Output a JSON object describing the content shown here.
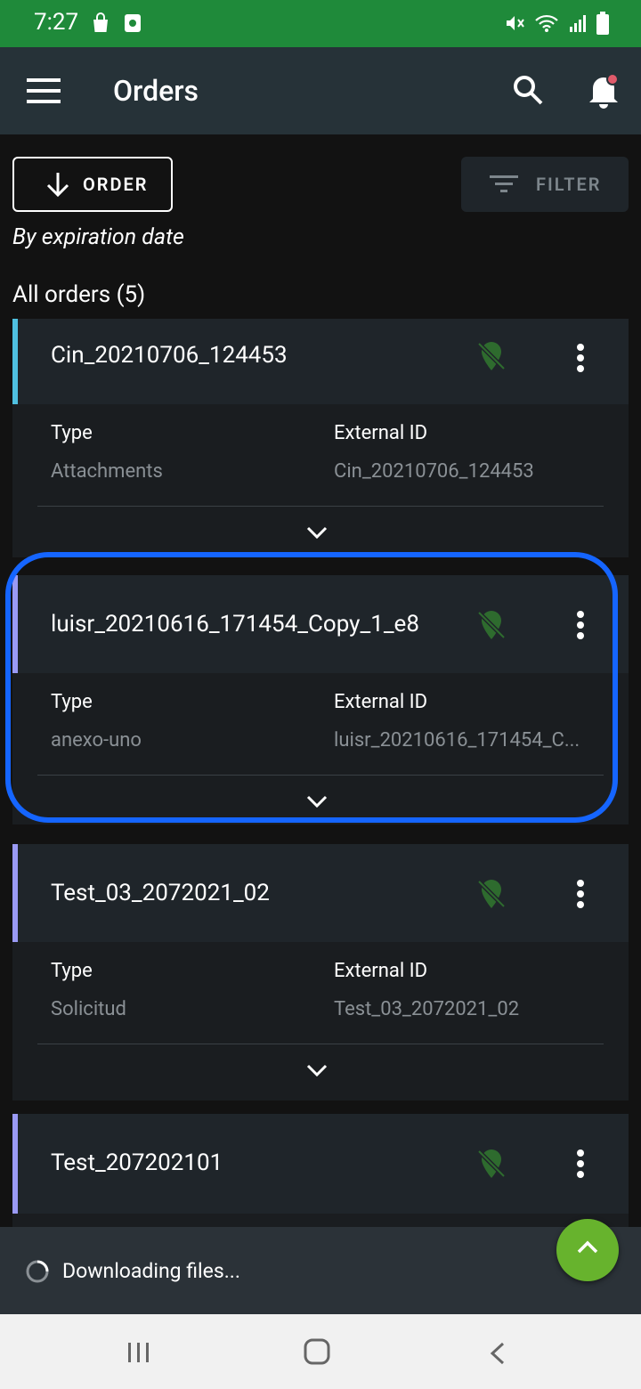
{
  "status_bar": {
    "time": "7:27"
  },
  "app_bar": {
    "title": "Orders",
    "notification_dot_color": "#e05a6a"
  },
  "toolbar": {
    "order_label": "ORDER",
    "filter_label": "FILTER",
    "sort_label": "By expiration date"
  },
  "list": {
    "header": "All orders (5)"
  },
  "field_labels": {
    "type": "Type",
    "external_id": "External ID"
  },
  "orders": [
    {
      "name": "Cin_20210706_124453",
      "type": "Attachments",
      "external_id": "Cin_20210706_124453"
    },
    {
      "name": "luisr_20210616_171454_Copy_1_e8",
      "type": "anexo-uno",
      "external_id": "luisr_20210616_171454_C..."
    },
    {
      "name": "Test_03_2072021_02",
      "type": "Solicitud",
      "external_id": "Test_03_2072021_02"
    },
    {
      "name": "Test_207202101"
    }
  ],
  "snackbar": {
    "message": "Downloading files..."
  },
  "colors": {
    "status_bar": "#1f8a3a",
    "app_bar": "#263238",
    "fab": "#67b32d",
    "highlight": "#1565ff",
    "accent_first": "#4fc0e0",
    "accent_other": "#9a9af5"
  }
}
